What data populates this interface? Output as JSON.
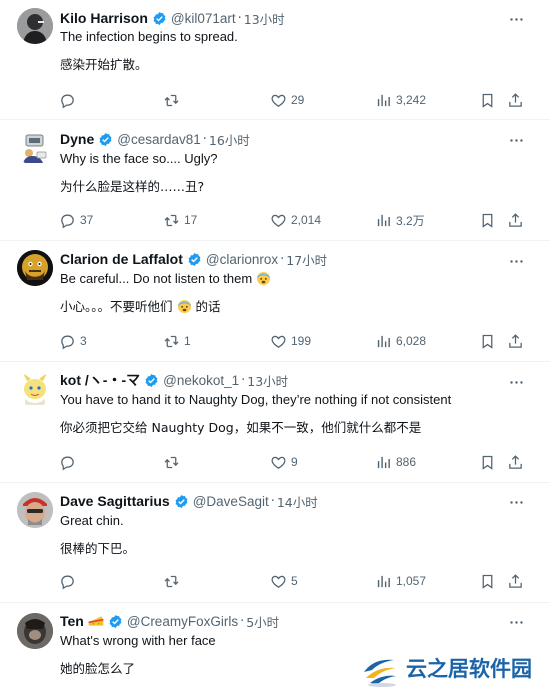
{
  "colors": {
    "verified": "#1d9bf0",
    "muted": "#536471",
    "text": "#0f1419",
    "divider": "#eff3f4",
    "watermark": "#1c64a8"
  },
  "tweets": [
    {
      "name": "Kilo Harrison",
      "handle": "@kil071art",
      "time": "13小时",
      "text": "The infection begins to spread.",
      "translation": "感染开始扩散。",
      "replies": "",
      "retweets": "",
      "likes": "29",
      "views": "3,242"
    },
    {
      "name": "Dyne",
      "handle": "@cesardav81",
      "time": "16小时",
      "text": "Why is the face so.... Ugly?",
      "translation": "为什么脸是这样的……丑?",
      "replies": "37",
      "retweets": "17",
      "likes": "2,014",
      "views": "3.2万"
    },
    {
      "name": "Clarion de Laffalot",
      "handle": "@clarionrox",
      "time": "17小时",
      "text": "Be careful... Do not listen to them",
      "translation_before": "小心。。。不要听他们",
      "translation_after": "的话",
      "replies": "3",
      "retweets": "1",
      "likes": "199",
      "views": "6,028"
    },
    {
      "name": "kot /ヽ-・-マ",
      "handle": "@nekokot_1",
      "time": "13小时",
      "text": "You have to hand it to Naughty Dog, they’re nothing if not consistent",
      "translation": "你必须把它交给 Naughty Dog，如果不一致，他们就什么都不是",
      "replies": "",
      "retweets": "",
      "likes": "9",
      "views": "886"
    },
    {
      "name": "Dave Sagittarius",
      "handle": "@DaveSagit",
      "time": "14小时",
      "text": "Great chin.",
      "translation": "很棒的下巴。",
      "replies": "",
      "retweets": "",
      "likes": "5",
      "views": "1,057"
    },
    {
      "name": "Ten",
      "handle": "@CreamyFoxGirls",
      "time": "5小时",
      "text": "What's wrong with her face",
      "translation": "她的脸怎么了"
    }
  ],
  "icons": {
    "reply": "reply-icon",
    "retweet": "retweet-icon",
    "like": "heart-icon",
    "views": "views-icon",
    "bookmark": "bookmark-icon",
    "share": "share-icon",
    "more": "more-icon",
    "verified": "verified-badge-icon"
  },
  "watermark": {
    "text": "云之居软件园"
  }
}
